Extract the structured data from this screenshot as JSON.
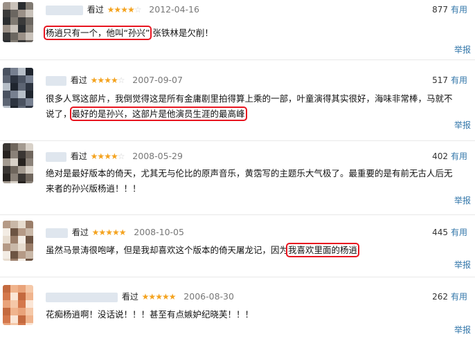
{
  "colors": {
    "star": "#f4a31f",
    "link": "#3377aa",
    "highlight_border": "#e8141f"
  },
  "reviews": [
    {
      "watched": "看过",
      "stars": "★★★★",
      "stars_off": "☆",
      "rating": 4,
      "date": "2012-04-16",
      "votes": "877",
      "useful": "有用",
      "comment_pre": "",
      "comment_hl": "杨逍只有一个，他叫“孙兴”",
      "comment_post": " 张铁林是欠削！",
      "report": "举报"
    },
    {
      "watched": "看过",
      "stars": "★★★★",
      "stars_off": "☆",
      "rating": 4,
      "date": "2007-09-07",
      "votes": "517",
      "useful": "有用",
      "comment_line1": "很多人骂这部片，我倒觉得这是所有金庸剧里拍得算上乘的一部，叶童演得其实很好，海味非常棒，马就不",
      "comment_pre": "说了，",
      "comment_hl": "最好的是孙兴，这部片是他演员生涯的最高峰",
      "comment_post": "",
      "report": "举报"
    },
    {
      "watched": "看过",
      "stars": "★★★★",
      "stars_off": "☆",
      "rating": 4,
      "date": "2008-05-29",
      "votes": "402",
      "useful": "有用",
      "comment_line1": "绝对是最好版本的倚天，尤其无与伦比的原声音乐，黄霑写的主题乐大气极了。最重要的是有前无古人后无",
      "comment_line2": "来者的孙兴版杨逍！！！",
      "report": "举报"
    },
    {
      "watched": "看过",
      "stars": "★★★★★",
      "rating": 5,
      "date": "2008-10-05",
      "votes": "445",
      "useful": "有用",
      "comment_pre": "虽然马景涛很咆哮，但是我却喜欢这个版本的倚天屠龙记，因为",
      "comment_hl": "我喜欢里面的杨逍",
      "comment_post": "",
      "report": "举报"
    },
    {
      "watched": "看过",
      "stars": "★★★★★",
      "rating": 5,
      "date": "2006-08-30",
      "votes": "262",
      "useful": "有用",
      "comment_line1": "花痴杨逍啊！没话说！！！甚至有点嫉妒纪晓芙！！！",
      "report": "举报"
    }
  ]
}
